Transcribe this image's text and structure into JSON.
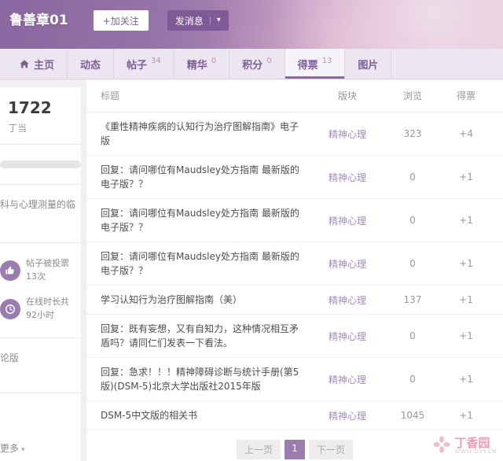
{
  "header": {
    "username": "鲁善章01",
    "follow_button": "+加关注",
    "message_button": "发消息"
  },
  "tabs": [
    {
      "label": "主页",
      "count": "",
      "icon": "home-icon",
      "active": false
    },
    {
      "label": "动态",
      "count": "",
      "active": false
    },
    {
      "label": "帖子",
      "count": "34",
      "active": false
    },
    {
      "label": "精华",
      "count": "0",
      "active": false
    },
    {
      "label": "积分",
      "count": "0",
      "active": false
    },
    {
      "label": "得票",
      "count": "13",
      "active": true
    },
    {
      "label": "图片",
      "count": "",
      "active": false
    }
  ],
  "sidebar": {
    "score": "1722",
    "score_label": "丁当",
    "cut_text_1": "科与心理测量的临",
    "stats": {
      "votes": {
        "line1": "帖子被投票",
        "line2": "13次"
      },
      "online": {
        "line1": "在线时长共",
        "line2": "92小时"
      }
    },
    "cut_text_2": "论版",
    "more_label": "更多"
  },
  "table": {
    "headers": {
      "title": "标题",
      "board": "版块",
      "views": "浏览",
      "votes": "得票"
    },
    "rows": [
      {
        "title": "《重性精神疾病的认知行为治疗图解指南》电子版",
        "board": "精神心理",
        "views": "323",
        "votes": "+4"
      },
      {
        "title": "回复：请问哪位有Maudsley处方指南 最新版的电子版？？",
        "board": "精神心理",
        "views": "0",
        "votes": "+1"
      },
      {
        "title": "回复：请问哪位有Maudsley处方指南 最新版的电子版？？",
        "board": "精神心理",
        "views": "0",
        "votes": "+1"
      },
      {
        "title": "回复：请问哪位有Maudsley处方指南 最新版的电子版？？",
        "board": "精神心理",
        "views": "0",
        "votes": "+1"
      },
      {
        "title": "学习认知行为治疗图解指南（美）",
        "board": "精神心理",
        "views": "137",
        "votes": "+1"
      },
      {
        "title": "回复：既有妄想，又有自知力，这种情况相互矛盾吗？请同仁们发表一下看法。",
        "board": "精神心理",
        "views": "0",
        "votes": "+1"
      },
      {
        "title": "回复：急求！！！精神障碍诊断与统计手册(第5版)(DSM-5)北京大学出版社2015年版",
        "board": "精神心理",
        "views": "0",
        "votes": "+1"
      },
      {
        "title": "DSM-5中文版的相关书",
        "board": "精神心理",
        "views": "1045",
        "votes": "+1"
      }
    ]
  },
  "pagination": {
    "prev": "上一页",
    "current": "1",
    "next": "下一页"
  },
  "watermark": {
    "site_name": "丁香园",
    "site_url": "WWW.DXY.CN"
  }
}
